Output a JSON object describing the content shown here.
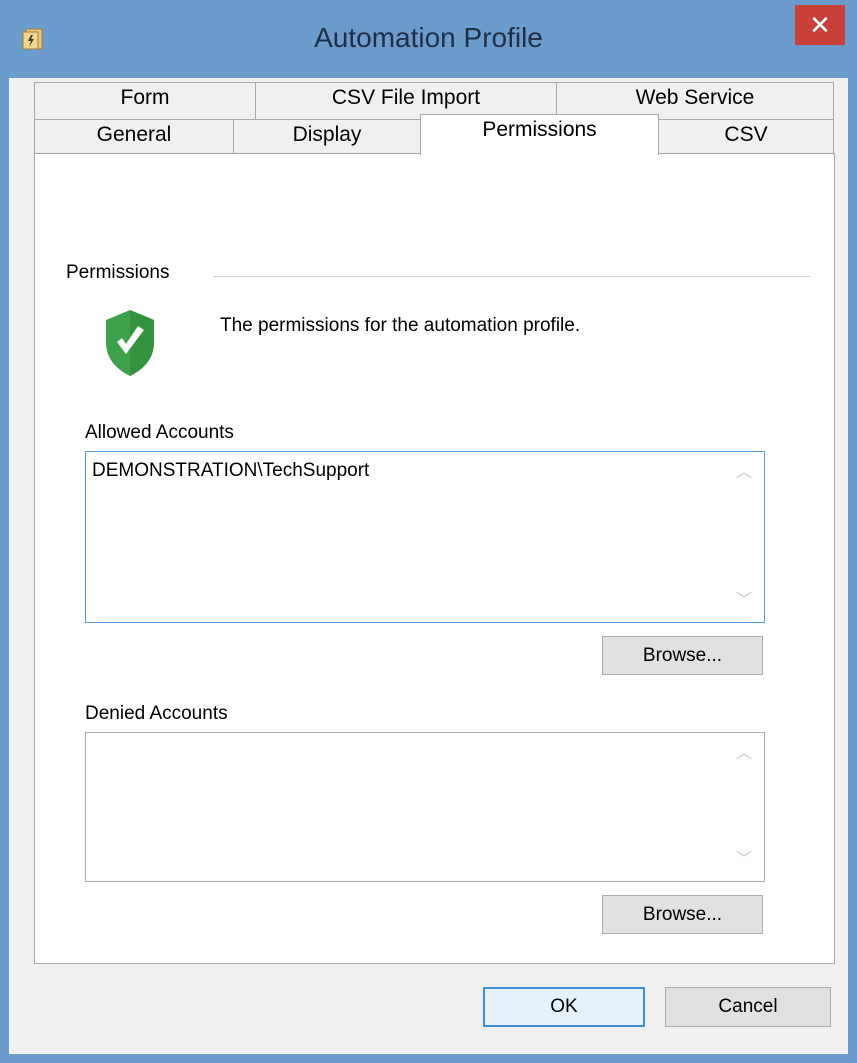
{
  "window": {
    "title": "Automation Profile",
    "close_glyph": "✕",
    "app_icon": "profile-app-icon"
  },
  "tabs": {
    "row_back": [
      {
        "label": "Form"
      },
      {
        "label": "CSV File Import"
      },
      {
        "label": "Web Service"
      }
    ],
    "row_front": [
      {
        "label": "General"
      },
      {
        "label": "Display"
      },
      {
        "label": "Permissions",
        "active": true
      },
      {
        "label": "CSV"
      }
    ]
  },
  "permissions": {
    "group_label": "Permissions",
    "icon": "shield-check-icon",
    "description": "The permissions for the automation profile.",
    "allowed": {
      "label": "Allowed Accounts",
      "items": [
        "DEMONSTRATION\\TechSupport"
      ],
      "browse_label": "Browse..."
    },
    "denied": {
      "label": "Denied Accounts",
      "items": [],
      "browse_label": "Browse..."
    }
  },
  "footer": {
    "ok_label": "OK",
    "cancel_label": "Cancel"
  },
  "colors": {
    "titlebar": "#6b9ccb",
    "close": "#c8403a",
    "shield": "#3ea04a",
    "default_button_border": "#3c8fd8"
  }
}
